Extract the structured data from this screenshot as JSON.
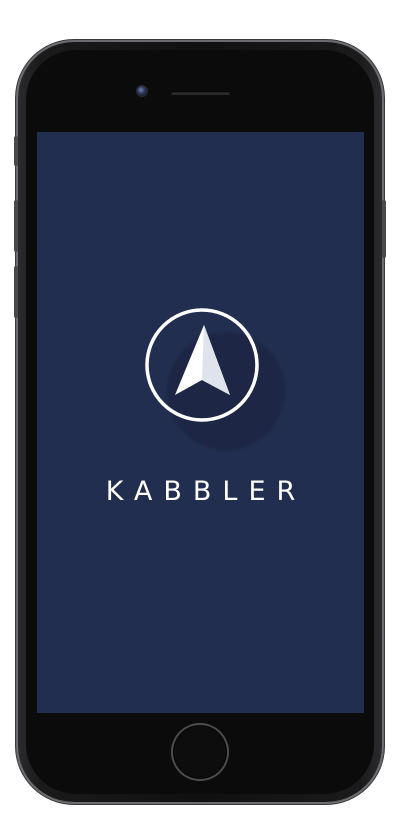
{
  "app": {
    "brand_name": "KABBLER",
    "logo_icon": "compass-arrow-icon"
  },
  "colors": {
    "screen_background": "#222e4f",
    "logo_stroke": "#ffffff",
    "device_frame": "#101011"
  }
}
